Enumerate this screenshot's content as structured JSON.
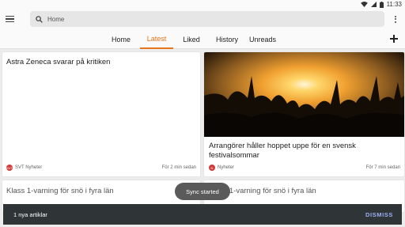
{
  "status_bar": {
    "time": "11:33"
  },
  "app_bar": {
    "search_label": "Home"
  },
  "tabs": [
    {
      "label": "Home",
      "active": false
    },
    {
      "label": "Latest",
      "active": true
    },
    {
      "label": "Liked",
      "active": false
    },
    {
      "label": "History",
      "active": false
    },
    {
      "label": "Unreads",
      "active": false
    }
  ],
  "cards": [
    {
      "title": "Astra Zeneca svarar på kritiken",
      "source": "SVT Nyheter",
      "time": "För 2 min sedan"
    },
    {
      "title": "Arrangörer håller hoppet uppe för en svensk festivalsommar",
      "source": "Nyheter",
      "time": "För 7 min sedan",
      "image": "festival-crowd-sunset"
    },
    {
      "title": "Klass 1-varning för snö i fyra län"
    },
    {
      "title": "Klass 1-varning för snö i fyra län"
    }
  ],
  "toast": {
    "text": "Sync started"
  },
  "snackbar": {
    "message": "1 nya artiklar",
    "action": "DISMISS"
  },
  "colors": {
    "accent": "#e8751a",
    "snackbar_bg": "#2f3437",
    "snackbar_action": "#9ab0f2"
  }
}
